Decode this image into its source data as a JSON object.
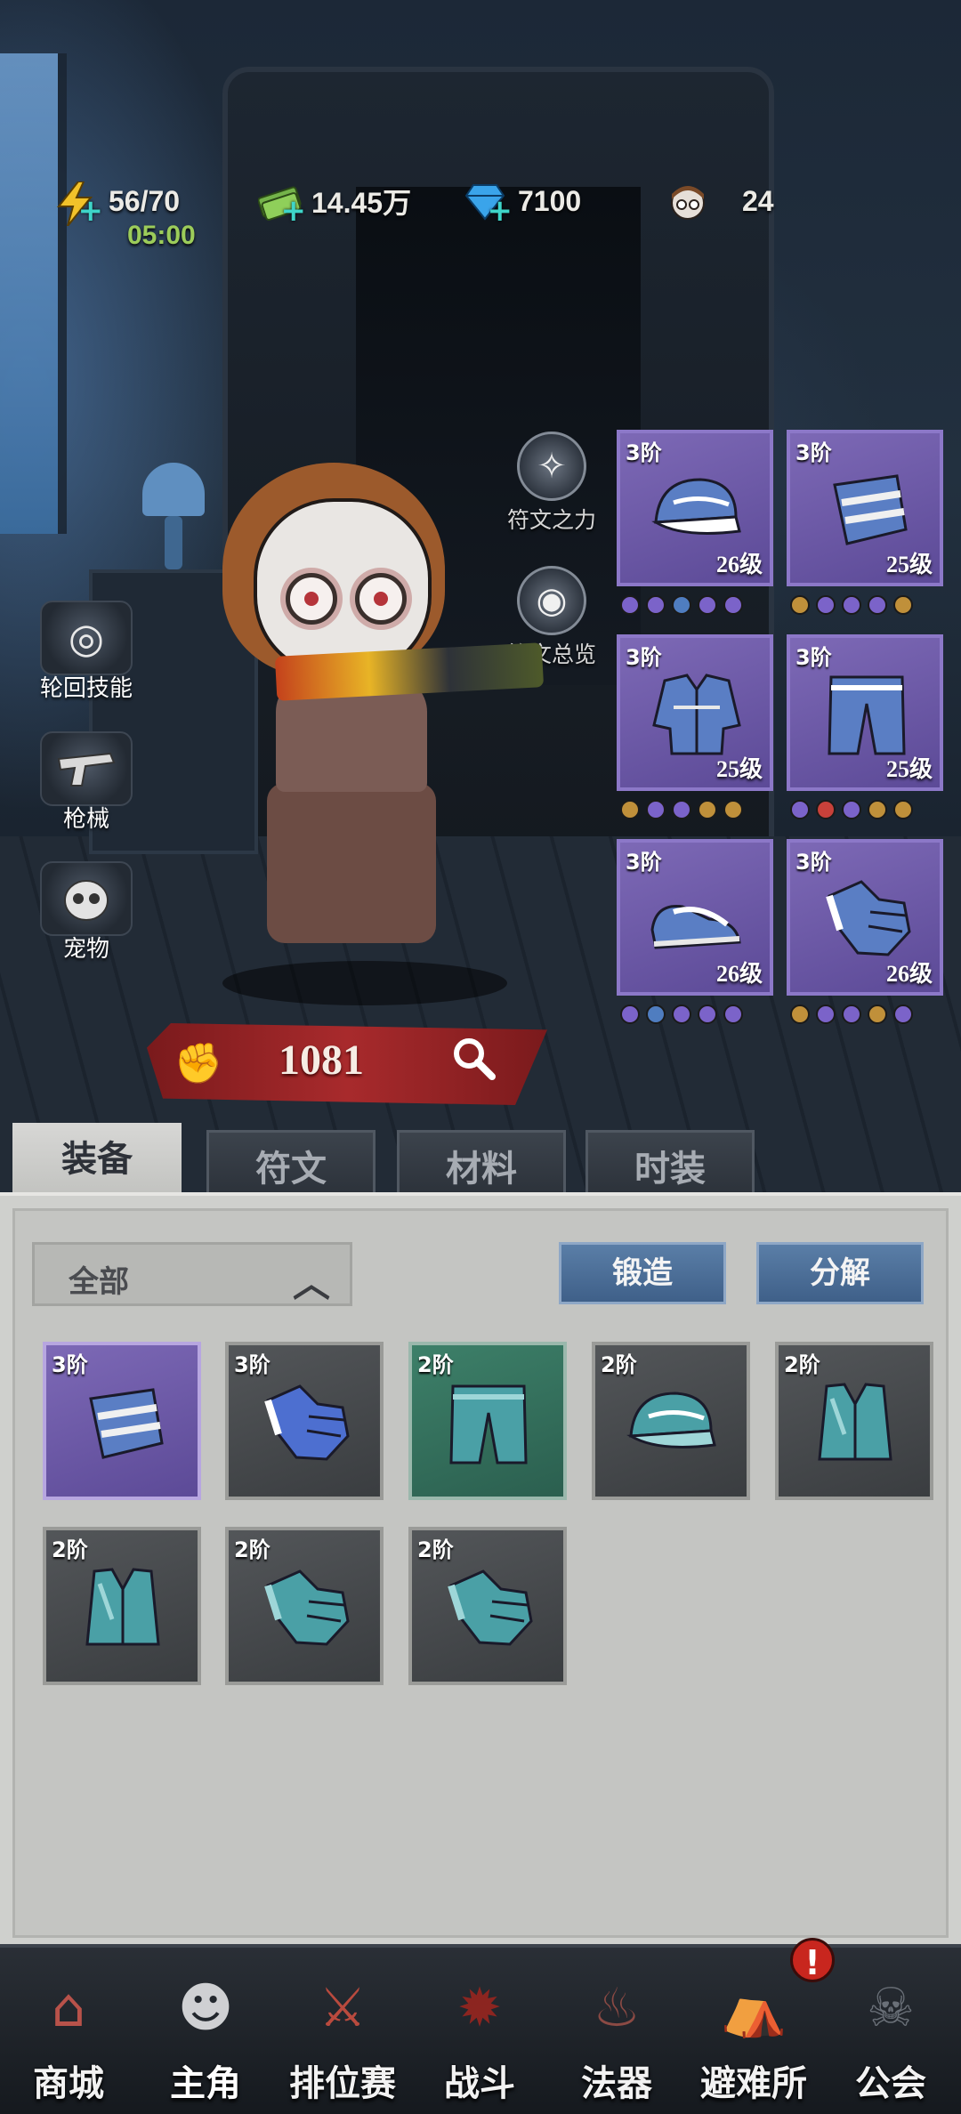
{
  "resources": {
    "stamina": {
      "value": "56/70",
      "timer": "05:00",
      "icon": "lightning-icon"
    },
    "cash": {
      "value": "14.45万",
      "icon": "cash-stack-icon"
    },
    "gems": {
      "value": "7100",
      "icon": "diamond-icon"
    },
    "tickets": {
      "value": "24",
      "icon": "character-head-icon"
    }
  },
  "side_buttons": [
    {
      "label": "轮回技能",
      "icon": "reincarnation-icon"
    },
    {
      "label": "枪械",
      "icon": "gun-icon"
    },
    {
      "label": "宠物",
      "icon": "pet-icon"
    }
  ],
  "rune_buttons": [
    {
      "label": "符文之力",
      "icon": "rune-power-icon"
    },
    {
      "label": "符文总览",
      "icon": "rune-overview-icon"
    }
  ],
  "equipped": [
    {
      "tier": "3阶",
      "level": "26级",
      "item": "cap",
      "dots": [
        "#7b63c9",
        "#7b63c9",
        "#4f7dc0",
        "#7b63c9",
        "#7b63c9"
      ]
    },
    {
      "tier": "3阶",
      "level": "25级",
      "item": "armguard",
      "dots": [
        "#c0903a",
        "#7b63c9",
        "#7b63c9",
        "#7b63c9",
        "#c0903a"
      ]
    },
    {
      "tier": "3阶",
      "level": "25级",
      "item": "jacket",
      "dots": [
        "#c0903a",
        "#7b63c9",
        "#7b63c9",
        "#c0903a",
        "#c0903a"
      ]
    },
    {
      "tier": "3阶",
      "level": "25级",
      "item": "pants",
      "dots": [
        "#7b63c9",
        "#c8413a",
        "#7b63c9",
        "#c0903a",
        "#c0903a"
      ]
    },
    {
      "tier": "3阶",
      "level": "26级",
      "item": "shoes",
      "dots": [
        "#7b63c9",
        "#4f7dc0",
        "#7b63c9",
        "#7b63c9",
        "#7b63c9"
      ]
    },
    {
      "tier": "3阶",
      "level": "26级",
      "item": "glove",
      "dots": [
        "#c0903a",
        "#7b63c9",
        "#7b63c9",
        "#c0903a",
        "#7b63c9"
      ]
    }
  ],
  "power": {
    "value": "1081"
  },
  "tabs": [
    {
      "label": "装备",
      "active": true
    },
    {
      "label": "符文",
      "active": false
    },
    {
      "label": "材料",
      "active": false
    },
    {
      "label": "时装",
      "active": false
    }
  ],
  "filter": {
    "label": "全部"
  },
  "actions": {
    "forge": "锻造",
    "dismantle": "分解"
  },
  "inventory": [
    {
      "tier": "3阶",
      "item": "armguard",
      "rarity": "purple"
    },
    {
      "tier": "3阶",
      "item": "glove",
      "rarity": "gray"
    },
    {
      "tier": "2阶",
      "item": "pants",
      "rarity": "green"
    },
    {
      "tier": "2阶",
      "item": "cap",
      "rarity": "gray"
    },
    {
      "tier": "2阶",
      "item": "vest",
      "rarity": "gray"
    },
    {
      "tier": "2阶",
      "item": "vest",
      "rarity": "gray"
    },
    {
      "tier": "2阶",
      "item": "glove",
      "rarity": "gray"
    },
    {
      "tier": "2阶",
      "item": "glove",
      "rarity": "gray"
    }
  ],
  "nav": [
    {
      "label": "商城",
      "icon": "shop-icon"
    },
    {
      "label": "主角",
      "icon": "hero-icon",
      "active": true
    },
    {
      "label": "排位赛",
      "icon": "ranked-icon"
    },
    {
      "label": "战斗",
      "icon": "battle-icon"
    },
    {
      "label": "法器",
      "icon": "artifact-icon"
    },
    {
      "label": "避难所",
      "icon": "shelter-icon",
      "badge": "!"
    },
    {
      "label": "公会",
      "icon": "guild-icon"
    }
  ],
  "colors": {
    "accent_purple": "#7d69b6",
    "power_red": "#a82a2c",
    "timer_green": "#9ccc5a",
    "plus_teal": "#3ed5c9",
    "button_blue": "#4f6f98"
  }
}
